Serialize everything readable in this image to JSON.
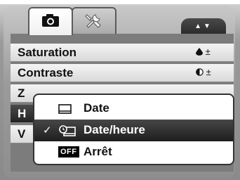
{
  "tabs": [
    {
      "icon": "camera-icon",
      "active": true
    },
    {
      "icon": "setup-wrench-icon",
      "active": false
    }
  ],
  "nav_arrows": "▲▼",
  "menu": {
    "rows": [
      {
        "label": "Saturation",
        "value": "±"
      },
      {
        "label": "Contraste",
        "value": "±"
      },
      {
        "label": "Z",
        "value": ""
      },
      {
        "label": "H",
        "value": ""
      },
      {
        "label": "V",
        "value": ""
      }
    ]
  },
  "popup": {
    "options": [
      {
        "label": "Date",
        "icon": "date-icon",
        "checked": false,
        "selected": false
      },
      {
        "label": "Date/heure",
        "icon": "date-time-icon",
        "checked": true,
        "selected": true
      },
      {
        "label": "Arrêt",
        "icon": "off-icon",
        "badge": "OFF",
        "checked": false,
        "selected": false
      }
    ],
    "check_mark": "✓"
  }
}
